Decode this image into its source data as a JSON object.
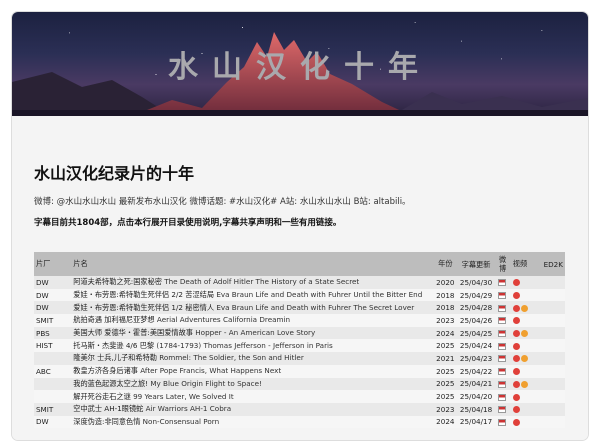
{
  "hero": {
    "title": "水山汉化十年"
  },
  "page": {
    "title": "水山汉化纪录片的十年",
    "info_line": "微博: @水山水山水山 最新发布水山汉化 微博话题: #水山汉化# A站: 水山水山水山 B站: altabili。",
    "note_line": "字幕目前共1804部，点击本行展开目录使用说明,字幕共享声明和一些有用链接。"
  },
  "table": {
    "headers": {
      "maker": "片厂",
      "name": "片名",
      "year": "年份",
      "date": "字幕更新",
      "weibo": "微博",
      "video": "视频",
      "ed2k": "ED2K"
    },
    "rows": [
      {
        "maker": "DW",
        "cn": "阿道夫希特勒之死:国家秘密",
        "en": "The Death of Adolf Hitler The History of a State Secret",
        "year": "2020",
        "date": "25/04/30",
        "video": [
          "red"
        ]
      },
      {
        "maker": "DW",
        "cn": "爱娃・布劳恩:希特勒生死伴侣 2/2 苦涩结局",
        "en": "Eva Braun Life and Death with Fuhrer Until the Bitter End",
        "year": "2018",
        "date": "25/04/29",
        "video": [
          "red"
        ]
      },
      {
        "maker": "DW",
        "cn": "爱娃・布劳恩:希特勒生死伴侣 1/2 秘密情人",
        "en": "Eva Braun Life and Death with Fuhrer The Secret Lover",
        "year": "2018",
        "date": "25/04/28",
        "video": [
          "red",
          "orange"
        ]
      },
      {
        "maker": "SMIT",
        "cn": "航拍奇遇 加利福尼亚梦想",
        "en": "Aerial Adventures California Dreamin",
        "year": "2023",
        "date": "25/04/26",
        "video": [
          "red"
        ]
      },
      {
        "maker": "PBS",
        "cn": "美国大师 爱德华・霍普:美国爱情故事",
        "en": "Hopper - An American Love Story",
        "year": "2024",
        "date": "25/04/25",
        "video": [
          "red",
          "orange"
        ]
      },
      {
        "maker": "HIST",
        "cn": "托马斯・杰斐逊 4/6 巴黎",
        "en": "(1784-1793) Thomas Jefferson - Jefferson in Paris",
        "year": "2025",
        "date": "25/04/24",
        "video": [
          "red"
        ]
      },
      {
        "maker": "",
        "cn": "隆美尔 士兵,儿子和希特勒",
        "en": "Rommel: The Soldier, the Son and Hitler",
        "year": "2021",
        "date": "25/04/23",
        "video": [
          "red",
          "orange"
        ]
      },
      {
        "maker": "ABC",
        "cn": "教皇方济各身后诸事",
        "en": "After Pope Francis, What Happens Next",
        "year": "2025",
        "date": "25/04/22",
        "video": [
          "red"
        ]
      },
      {
        "maker": "",
        "cn": "我的蓝色起源太空之旅!",
        "en": "My Blue Origin Flight to Space!",
        "year": "2025",
        "date": "25/04/21",
        "video": [
          "red",
          "orange"
        ]
      },
      {
        "maker": "",
        "cn": "解开死谷走石之谜",
        "en": "99 Years Later, We Solved It",
        "year": "2025",
        "date": "25/04/20",
        "video": [
          "red"
        ]
      },
      {
        "maker": "SMIT",
        "cn": "空中武士 AH-1眼镜蛇",
        "en": "Air Warriors AH-1 Cobra",
        "year": "2023",
        "date": "25/04/18",
        "video": [
          "red"
        ]
      },
      {
        "maker": "DW",
        "cn": "深度伪造:非同意色情",
        "en": "Non-Consensual Porn",
        "year": "2024",
        "date": "25/04/17",
        "video": [
          "red"
        ]
      }
    ]
  }
}
